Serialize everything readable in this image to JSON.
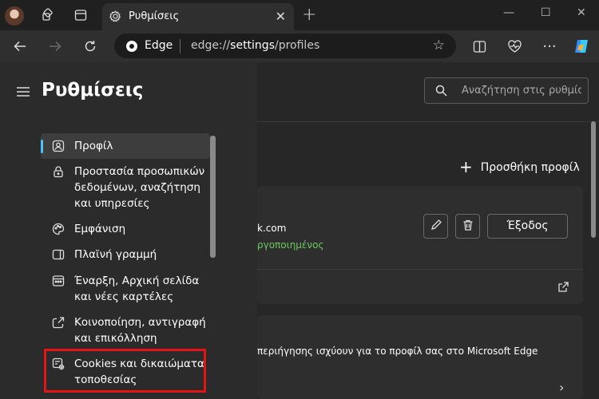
{
  "browser": {
    "tab_title": "Ρυθμίσεις",
    "omnibox_brand": "Edge",
    "url_prefix": "edge://",
    "url_main": "settings",
    "url_suffix": "/profiles"
  },
  "header": {
    "search_placeholder": "Αναζήτηση στις ρυθμίσ..."
  },
  "sidebar": {
    "title": "Ρυθμίσεις",
    "items": [
      {
        "label": "Προφίλ",
        "icon": "profile-icon",
        "active": true
      },
      {
        "label": "Προστασία προσωπικών δεδομένων, αναζήτηση και υπηρεσίες",
        "icon": "lock-icon"
      },
      {
        "label": "Εμφάνιση",
        "icon": "palette-icon"
      },
      {
        "label": "Πλαϊνή γραμμή",
        "icon": "sidebar-icon"
      },
      {
        "label": "Έναρξη, Αρχική σελίδα και νέες καρτέλες",
        "icon": "home-tabs-icon"
      },
      {
        "label": "Κοινοποίηση, αντιγραφή και επικόλληση",
        "icon": "share-icon"
      },
      {
        "label": "Cookies και δικαιώματα τοποθεσίας",
        "icon": "cookies-icon"
      }
    ]
  },
  "main": {
    "add_profile_label": "Προσθήκη προφίλ",
    "email_fragment": "k.com",
    "status_fragment": "ργοποιημένος",
    "signout_label": "Έξοδος",
    "sync_fragment": "περιήγησης ισχύουν για το προφίλ σας στο Microsoft Edge"
  },
  "colors": {
    "accent": "#4cc2ff",
    "highlight": "#e41414",
    "status_green": "#6ccb5f"
  }
}
